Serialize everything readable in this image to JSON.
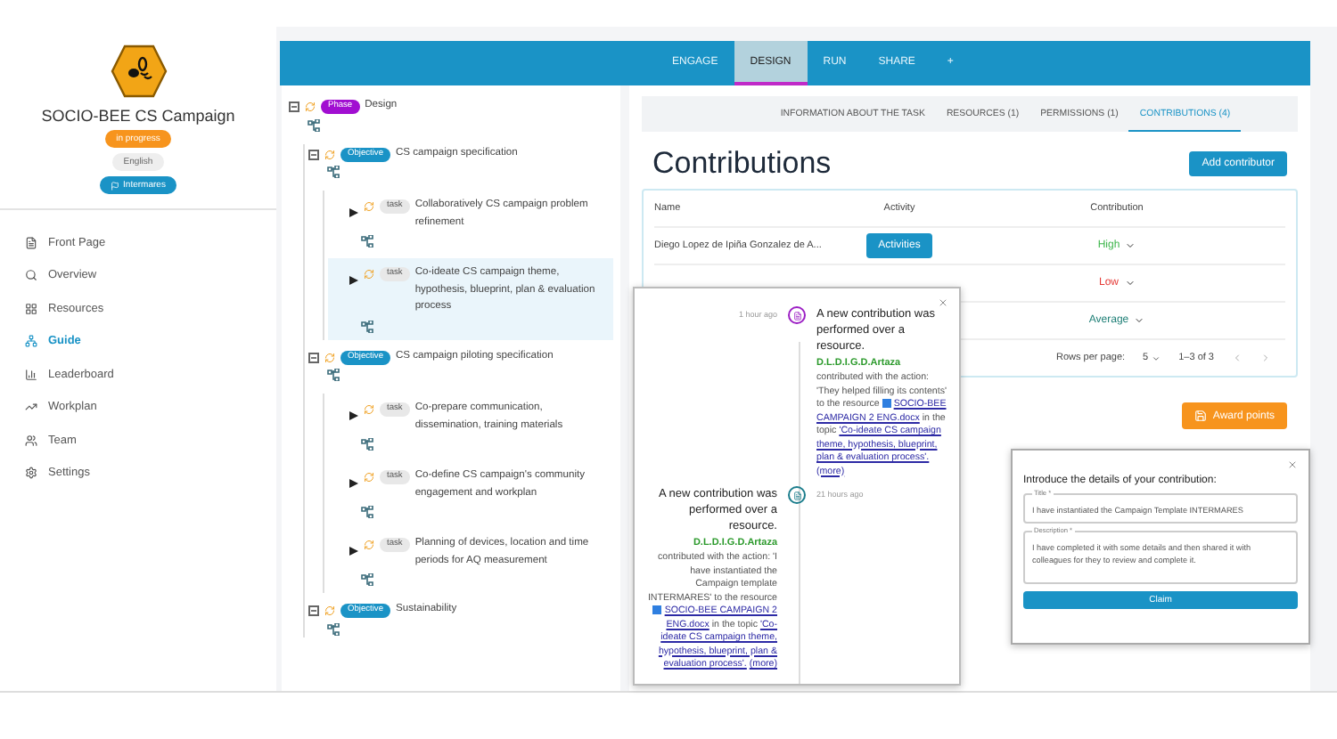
{
  "campaign": {
    "title": "SOCIO-BEE CS Campaign",
    "status": "in progress",
    "language": "English",
    "organization": "Intermares"
  },
  "sidebar": {
    "items": [
      {
        "label": "Front Page",
        "selected": false
      },
      {
        "label": "Overview",
        "selected": false
      },
      {
        "label": "Resources",
        "selected": false
      },
      {
        "label": "Guide",
        "selected": true
      },
      {
        "label": "Leaderboard",
        "selected": false
      },
      {
        "label": "Workplan",
        "selected": false
      },
      {
        "label": "Team",
        "selected": false
      },
      {
        "label": "Settings",
        "selected": false
      }
    ]
  },
  "phase_tabs": [
    {
      "label": "ENGAGE",
      "selected": false
    },
    {
      "label": "DESIGN",
      "selected": true
    },
    {
      "label": "RUN",
      "selected": false
    },
    {
      "label": "SHARE",
      "selected": false
    },
    {
      "label": "+",
      "selected": false
    }
  ],
  "tree": [
    {
      "tag": "Phase",
      "kind": "phase",
      "label": "Design",
      "selected": false,
      "expanded": true,
      "children": [
        {
          "tag": "Objective",
          "kind": "objective",
          "label": "CS campaign specification",
          "selected": false,
          "expanded": true,
          "children": [
            {
              "tag": "task",
              "kind": "task",
              "label": "Collaboratively CS campaign problem refinement",
              "selected": false
            },
            {
              "tag": "task",
              "kind": "task",
              "label": "Co-ideate CS campaign theme, hypothesis, blueprint, plan & evaluation process",
              "selected": true
            }
          ]
        },
        {
          "tag": "Objective",
          "kind": "objective",
          "label": "CS campaign piloting specification",
          "selected": false,
          "expanded": true,
          "children": [
            {
              "tag": "task",
              "kind": "task",
              "label": "Co-prepare communication, dissemination, training materials",
              "selected": false
            },
            {
              "tag": "task",
              "kind": "task",
              "label": "Co-define CS campaign's community engagement and workplan",
              "selected": false
            },
            {
              "tag": "task",
              "kind": "task",
              "label": "Planning of devices, location and time periods for AQ measurement",
              "selected": false
            }
          ]
        },
        {
          "tag": "Objective",
          "kind": "objective",
          "label": "Sustainability",
          "selected": false,
          "expanded": true
        }
      ]
    }
  ],
  "task_tabs": [
    {
      "label": "INFORMATION ABOUT THE TASK",
      "selected": false
    },
    {
      "label": "RESOURCES (1)",
      "selected": false
    },
    {
      "label": "PERMISSIONS (1)",
      "selected": false
    },
    {
      "label": "CONTRIBUTIONS (4)",
      "selected": true
    }
  ],
  "contributions": {
    "title": "Contributions",
    "add_button": "Add contributor",
    "table": {
      "columns": [
        "Name",
        "Activity",
        "Contribution"
      ],
      "rows": [
        {
          "name": "Diego Lopez de Ipiña Gonzalez de A...",
          "activity": "Activities",
          "contribution": "High",
          "color": "#3cb54a"
        },
        {
          "contribution": "Low",
          "color": "#e53935"
        },
        {
          "contribution": "Average",
          "color": "#1b7d74"
        }
      ]
    },
    "pagination": {
      "rows_label": "Rows per page:",
      "rows_value": "5",
      "range": "1–3 of 3"
    },
    "award_button": "Award points"
  },
  "notifications": [
    {
      "kind": "right",
      "color": "#9c1fc4",
      "time": "1 hour ago",
      "title": "A new contribution was performed over a resource.",
      "user": "D.L.D.I.G.D.Artaza",
      "before": "contributed with the action: 'They helped filling its contents' to the resource",
      "resource": "SOCIO-BEE CAMPAIGN 2 ENG.docx",
      "middle": "in the topic",
      "topic": "'Co-ideate CS campaign theme, hypothesis, blueprint, plan & evaluation process'.",
      "more": "(more)"
    },
    {
      "kind": "left",
      "color": "#1b7d8c",
      "time": "21 hours ago",
      "title": "A new contribution was performed over a resource.",
      "user": "D.L.D.I.G.D.Artaza",
      "before": "contributed with the action: 'I have instantiated the Campaign template INTERMARES' to the resource",
      "resource": "SOCIO-BEE CAMPAIGN 2 ENG.docx",
      "middle": "in the topic",
      "topic": "'Co-ideate CS campaign theme, hypothesis, blueprint, plan & evaluation process'.",
      "more": "(more)"
    }
  ],
  "dialog": {
    "heading": "Introduce the details of your contribution:",
    "title_label": "Title *",
    "title_value": "I have instantiated the Campaign Template INTERMARES",
    "description_label": "Description *",
    "description_value": "I have completed it with some details and then shared it with colleagues for they to review and complete it.",
    "button": "Claim"
  }
}
